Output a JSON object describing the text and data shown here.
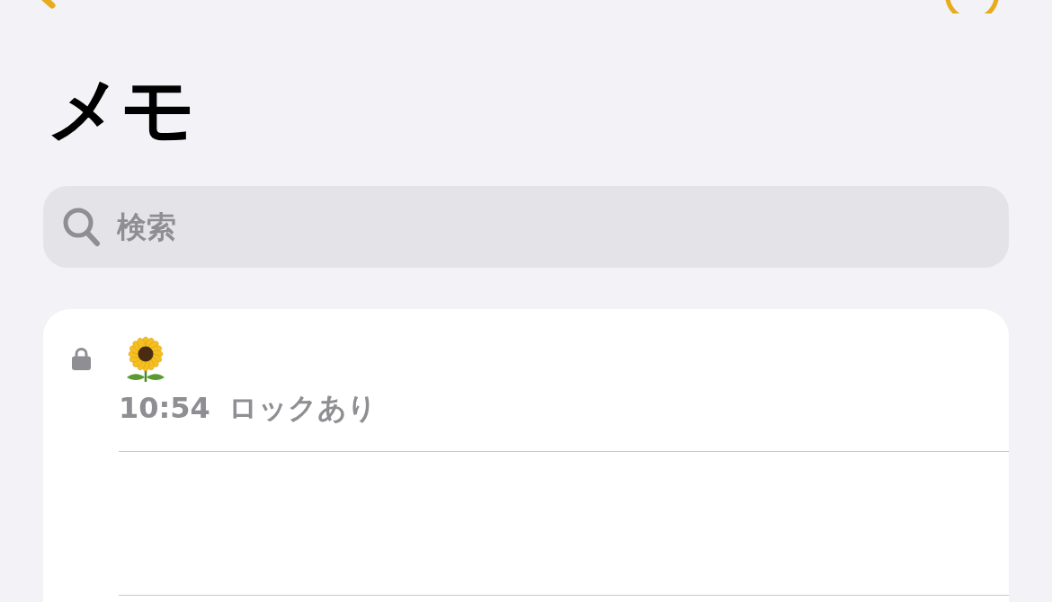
{
  "title": "メモ",
  "search": {
    "placeholder": "検索"
  },
  "notes": [
    {
      "locked": true,
      "time": "10:54",
      "preview": "ロックあり"
    }
  ]
}
